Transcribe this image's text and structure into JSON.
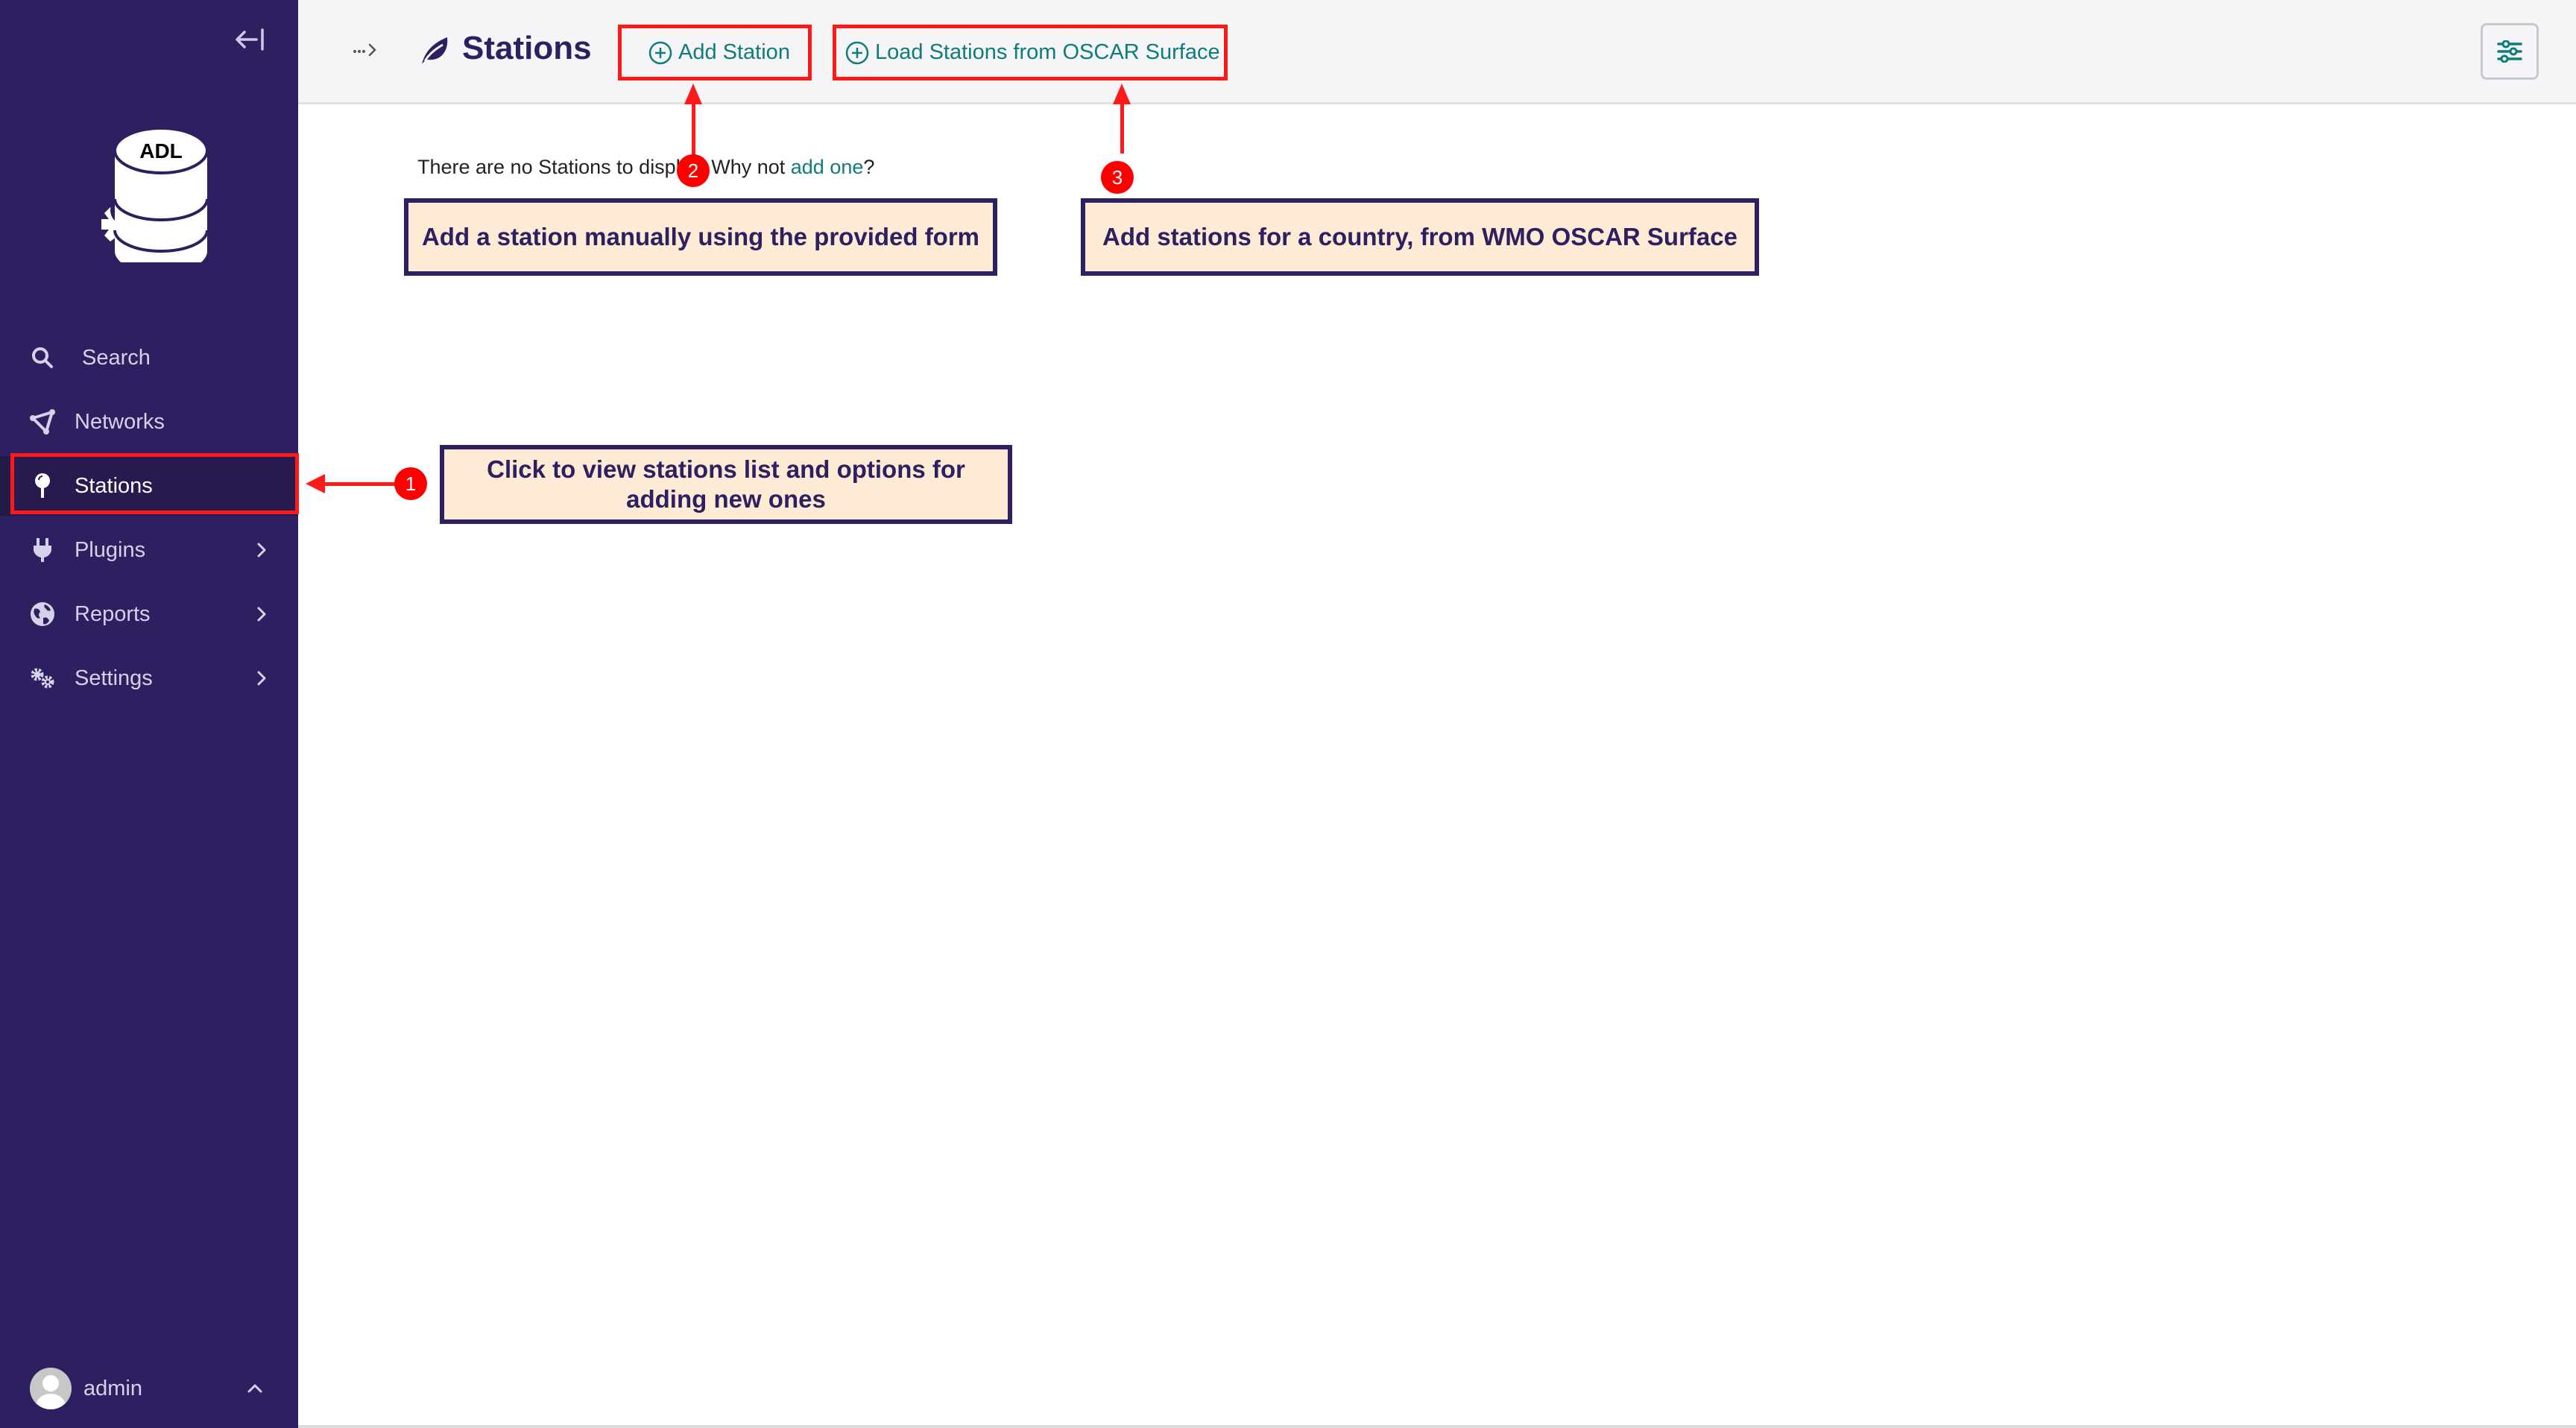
{
  "sidebar": {
    "collapse_icon": "collapse-left-icon",
    "logo": {
      "text": "ADL",
      "icon": "database-gear-icon"
    },
    "items": [
      {
        "label": "Search",
        "icon": "search-icon",
        "has_submenu": false,
        "active": false
      },
      {
        "label": "Networks",
        "icon": "network-icon",
        "has_submenu": false,
        "active": false
      },
      {
        "label": "Stations",
        "icon": "pin-icon",
        "has_submenu": false,
        "active": true
      },
      {
        "label": "Plugins",
        "icon": "plug-icon",
        "has_submenu": true,
        "active": false
      },
      {
        "label": "Reports",
        "icon": "globe-icon",
        "has_submenu": true,
        "active": false
      },
      {
        "label": "Settings",
        "icon": "gears-icon",
        "has_submenu": true,
        "active": false
      }
    ],
    "user": {
      "name": "admin",
      "icon": "avatar-icon"
    }
  },
  "header": {
    "breadcrumb_icon": "breadcrumb-ellipsis-icon",
    "title": "Stations",
    "title_icon": "leaf-icon",
    "actions": [
      {
        "label": "Add Station",
        "icon": "plus-circle-icon"
      },
      {
        "label": "Load Stations from OSCAR Surface",
        "icon": "plus-circle-icon"
      }
    ],
    "settings_icon": "sliders-icon"
  },
  "main": {
    "empty_prefix": "There are no Stations to display. Why not ",
    "empty_link": "add one",
    "empty_suffix": "?"
  },
  "annotations": {
    "callouts": [
      {
        "number": "1",
        "text": "Click to view stations list and options for adding new ones"
      },
      {
        "number": "2",
        "text": "Add a station manually using the provided form"
      },
      {
        "number": "3",
        "text": "Add stations for a country, from WMO OSCAR Surface"
      }
    ]
  },
  "colors": {
    "sidebar_bg": "#2e2060",
    "accent": "#0e7c78",
    "annotation_red": "#ff1a1a",
    "callout_bg": "#fdebd5"
  }
}
